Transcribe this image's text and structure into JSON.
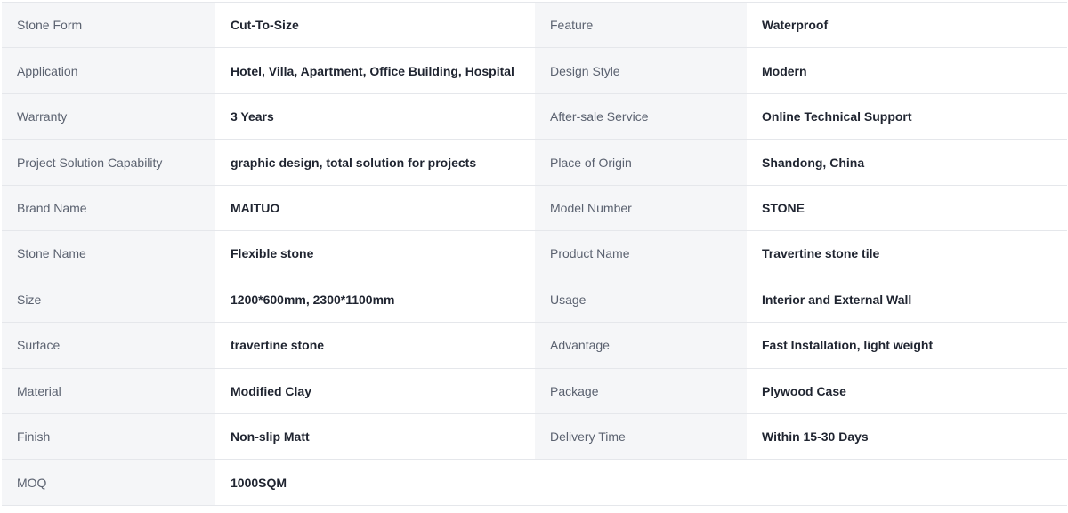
{
  "specs": [
    {
      "label1": "Stone Form",
      "value1": "Cut-To-Size",
      "label2": "Feature",
      "value2": "Waterproof"
    },
    {
      "label1": "Application",
      "value1": "Hotel, Villa, Apartment, Office Building, Hospital",
      "label2": "Design Style",
      "value2": "Modern"
    },
    {
      "label1": "Warranty",
      "value1": "3 Years",
      "label2": "After-sale Service",
      "value2": "Online Technical Support"
    },
    {
      "label1": "Project Solution Capability",
      "value1": "graphic design, total solution for projects",
      "label2": "Place of Origin",
      "value2": "Shandong, China"
    },
    {
      "label1": "Brand Name",
      "value1": "MAITUO",
      "label2": "Model Number",
      "value2": "STONE"
    },
    {
      "label1": "Stone Name",
      "value1": "Flexible stone",
      "label2": "Product Name",
      "value2": "Travertine stone tile"
    },
    {
      "label1": "Size",
      "value1": "1200*600mm, 2300*1100mm",
      "label2": "Usage",
      "value2": "Interior and External Wall"
    },
    {
      "label1": "Surface",
      "value1": "travertine stone",
      "label2": "Advantage",
      "value2": "Fast Installation, light weight"
    },
    {
      "label1": "Material",
      "value1": "Modified Clay",
      "label2": "Package",
      "value2": "Plywood Case"
    },
    {
      "label1": "Finish",
      "value1": "Non-slip Matt",
      "label2": "Delivery Time",
      "value2": "Within 15-30 Days"
    },
    {
      "label1": "MOQ",
      "value1": "1000SQM",
      "label2": "",
      "value2": ""
    }
  ]
}
